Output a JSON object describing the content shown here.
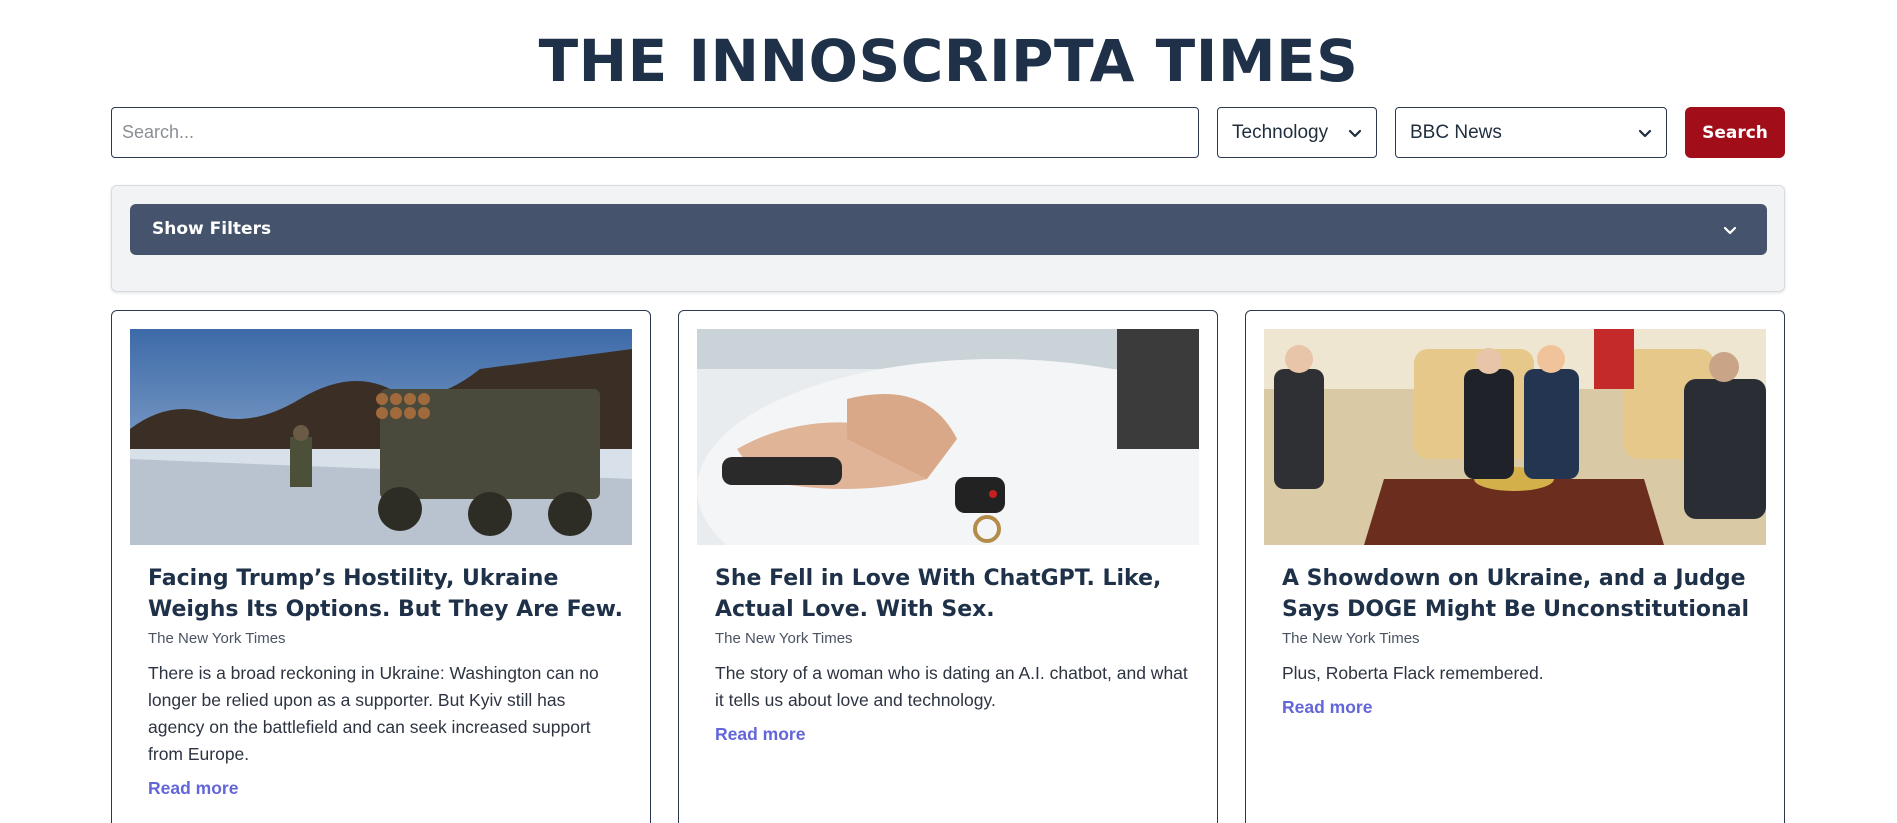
{
  "masthead": {
    "title": "THE INNOSCRIPTA TIMES"
  },
  "search": {
    "placeholder": "Search...",
    "category_selected": "Technology",
    "source_selected": "BBC News",
    "button_label": "Search"
  },
  "filters": {
    "toggle_label": "Show Filters"
  },
  "colors": {
    "brand_navy": "#1e3148",
    "search_button": "#a10d18",
    "filter_bar": "#45546c",
    "link": "#6366d8"
  },
  "articles": [
    {
      "title": "Facing Trump’s Hostility, Ukraine Weighs Its Options. But They Are Few.",
      "source": "The New York Times",
      "description": "There is a broad reckoning in Ukraine: Washington can no longer be relied upon as a supporter. But Kyiv still has agency on the battlefield and can seek increased support from Europe.",
      "read_more": "Read more",
      "image": "rocket-launcher-truck-in-snowy-field"
    },
    {
      "title": "She Fell in Love With ChatGPT. Like, Actual Love. With Sex.",
      "source": "The New York Times",
      "description": "The story of a woman who is dating an A.I. chatbot, and what it tells us about love and technology.",
      "read_more": "Read more",
      "image": "hands-holding-phone-with-car-key"
    },
    {
      "title": "A Showdown on Ukraine, and a Judge Says DOGE Might Be Unconstitutional",
      "source": "The New York Times",
      "description": "Plus, Roberta Flack remembered.",
      "read_more": "Read more",
      "image": "oval-office-meeting"
    }
  ]
}
